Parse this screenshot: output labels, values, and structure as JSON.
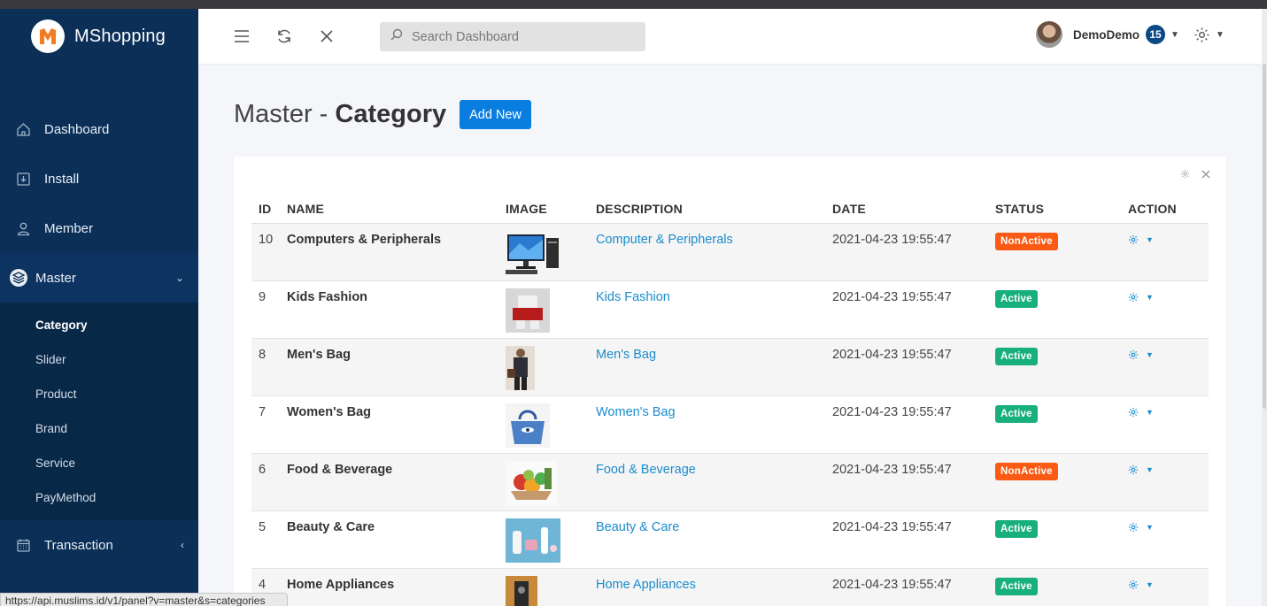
{
  "app": {
    "brand": "MShopping"
  },
  "sidebar": {
    "items": [
      {
        "label": "Dashboard",
        "icon": "home-icon"
      },
      {
        "label": "Install",
        "icon": "install-icon"
      },
      {
        "label": "Member",
        "icon": "user-icon"
      },
      {
        "label": "Master",
        "icon": "layers-icon"
      },
      {
        "label": "Transaction",
        "icon": "calendar-icon"
      }
    ],
    "submenu": [
      "Category",
      "Slider",
      "Product",
      "Brand",
      "Service",
      "PayMethod"
    ]
  },
  "topbar": {
    "search_placeholder": "Search Dashboard",
    "user_name": "DemoDemo",
    "notification_count": "15"
  },
  "page": {
    "title_prefix": "Master - ",
    "title_main": "Category",
    "add_button": "Add New"
  },
  "table": {
    "headers": {
      "id": "ID",
      "name": "NAME",
      "image": "IMAGE",
      "description": "DESCRIPTION",
      "date": "DATE",
      "status": "STATUS",
      "action": "ACTION"
    },
    "rows": [
      {
        "id": "10",
        "name": "Computers & Peripherals",
        "description": "Computer & Peripherals",
        "date": "2021-04-23 19:55:47",
        "status": "NonActive"
      },
      {
        "id": "9",
        "name": "Kids Fashion",
        "description": "Kids Fashion",
        "date": "2021-04-23 19:55:47",
        "status": "Active"
      },
      {
        "id": "8",
        "name": "Men's Bag",
        "description": "Men's Bag",
        "date": "2021-04-23 19:55:47",
        "status": "Active"
      },
      {
        "id": "7",
        "name": "Women's Bag",
        "description": "Women's Bag",
        "date": "2021-04-23 19:55:47",
        "status": "Active"
      },
      {
        "id": "6",
        "name": "Food & Beverage",
        "description": "Food & Beverage",
        "date": "2021-04-23 19:55:47",
        "status": "NonActive"
      },
      {
        "id": "5",
        "name": "Beauty & Care",
        "description": "Beauty & Care",
        "date": "2021-04-23 19:55:47",
        "status": "Active"
      },
      {
        "id": "4",
        "name": "Home Appliances",
        "description": "Home Appliances",
        "date": "2021-04-23 19:55:47",
        "status": "Active"
      }
    ]
  },
  "status_colors": {
    "Active": "#17b07b",
    "NonActive": "#fa5a13"
  },
  "statusbar": {
    "url": "https://api.muslims.id/v1/panel?v=master&s=categories"
  }
}
